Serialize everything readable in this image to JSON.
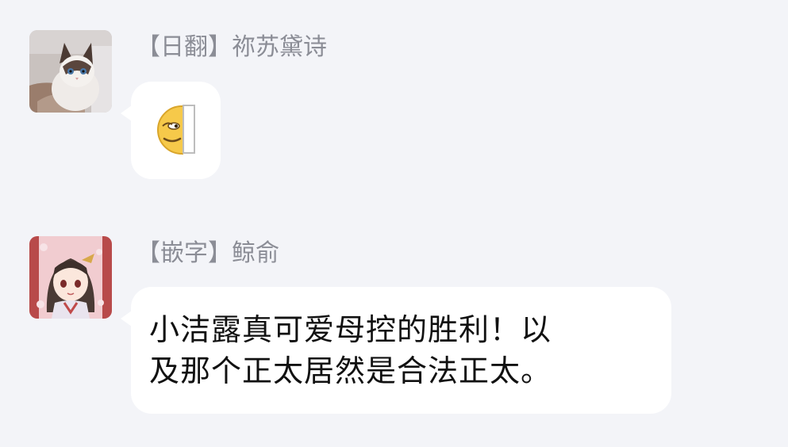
{
  "theme": {
    "background": "#f3f4f8",
    "bubble": "#ffffff",
    "sender_color": "#8b8d96",
    "text_color": "#111111"
  },
  "messages": [
    {
      "sender": "【日翻】祢苏黛诗",
      "avatar_icon": "cat-avatar",
      "type": "emoji",
      "emoji": "peeking-face-emoji"
    },
    {
      "sender": "【嵌字】鲸俞",
      "avatar_icon": "anime-girl-avatar",
      "type": "text",
      "lines": [
        "小洁露真可爱母控的胜利！以",
        "及那个正太居然是合法正太。"
      ]
    }
  ]
}
